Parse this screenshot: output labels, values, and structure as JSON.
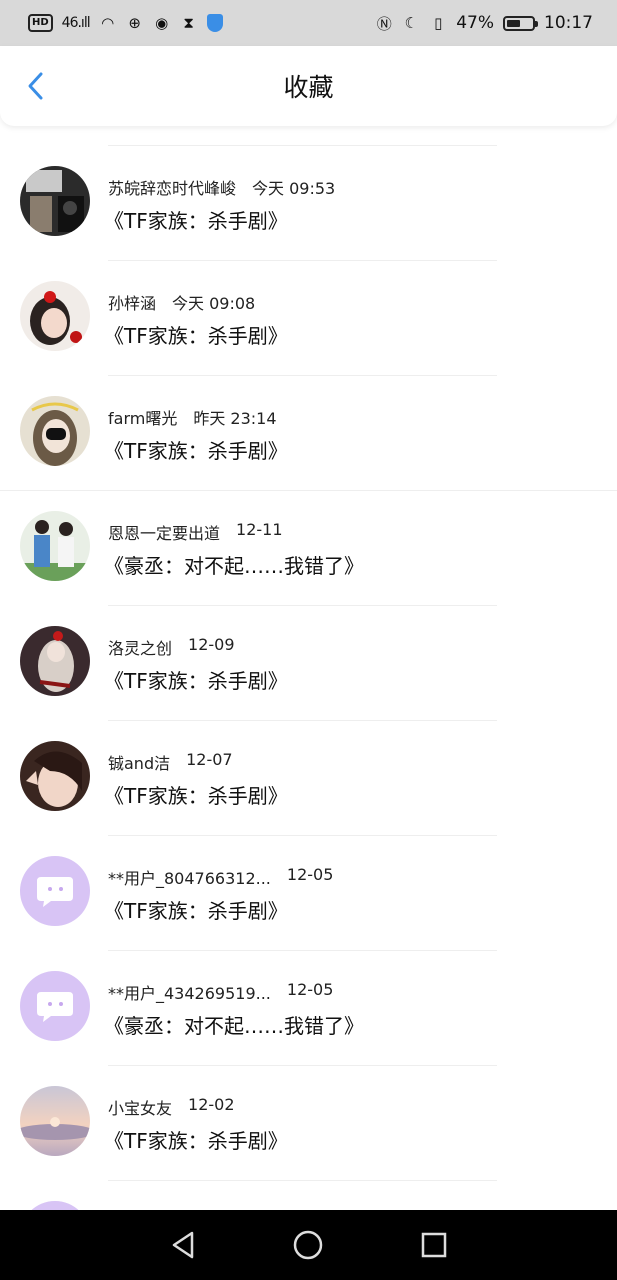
{
  "status_bar": {
    "hd": "HD",
    "signal": "46.ıll",
    "battery_percent": "47%",
    "time": "10:17"
  },
  "header": {
    "title": "收藏"
  },
  "favorites": [
    {
      "user": "苏皖辞恋时代峰峻",
      "time": "今天 09:53",
      "work": "《TF家族：杀手剧》",
      "avatar": "photo"
    },
    {
      "user": "孙梓涵",
      "time": "今天 09:08",
      "work": "《TF家族：杀手剧》",
      "avatar": "photo"
    },
    {
      "user": "farm曙光",
      "time": "昨天 23:14",
      "work": "《TF家族：杀手剧》",
      "avatar": "photo"
    },
    {
      "user": "恩恩一定要出道",
      "time": "12-11",
      "work": "《豪丞：对不起……我错了》",
      "avatar": "photo"
    },
    {
      "user": "洛灵之创",
      "time": "12-09",
      "work": "《TF家族：杀手剧》",
      "avatar": "photo"
    },
    {
      "user": "铖and洁",
      "time": "12-07",
      "work": "《TF家族：杀手剧》",
      "avatar": "photo"
    },
    {
      "user": "**用户_804766312...",
      "time": "12-05",
      "work": "《TF家族：杀手剧》",
      "avatar": "default-chat-icon"
    },
    {
      "user": "**用户_434269519...",
      "time": "12-05",
      "work": "《豪丞：对不起……我错了》",
      "avatar": "default-chat-icon"
    },
    {
      "user": "小宝女友",
      "time": "12-02",
      "work": "《TF家族：杀手剧》",
      "avatar": "photo"
    }
  ],
  "colors": {
    "accent": "#3a8ee6",
    "default_avatar_bg": "#d8c4f5",
    "status_bar_bg": "#d9d9d9",
    "nav_bar_bg": "#000000"
  },
  "icons": {
    "back": "chevron-left-icon",
    "nav_back": "triangle-back-icon",
    "nav_home": "circle-home-icon",
    "nav_recents": "square-recents-icon"
  }
}
